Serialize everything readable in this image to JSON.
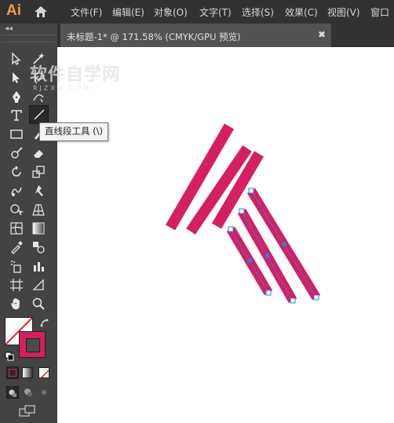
{
  "app": {
    "logo": "Ai"
  },
  "menu": [
    "文件(F)",
    "编辑(E)",
    "对象(O)",
    "文字(T)",
    "选择(S)",
    "效果(C)",
    "视图(V)",
    "窗口"
  ],
  "document_tab": {
    "title": "未标题-1* @ 171.58% (CMYK/GPU 预览)",
    "close_symbol": "✖"
  },
  "toolbar": {
    "collapse_symbol": "◂◂"
  },
  "tooltip": {
    "text": "直线段工具 (\\)"
  },
  "watermark": {
    "main": "软件自学网",
    "sub": "RJZXW.COM"
  },
  "colors": {
    "stroke_color": "#d42060",
    "selection_color": "#3a78e0",
    "fill": "none"
  },
  "icons": {
    "selection": "selection-arrow-icon",
    "direct_selection": "direct-selection-icon",
    "magic_wand": "magic-wand-icon",
    "lasso": "lasso-icon",
    "pen": "pen-icon",
    "curvature": "curvature-icon",
    "type": "type-icon",
    "line_segment": "line-segment-icon"
  }
}
